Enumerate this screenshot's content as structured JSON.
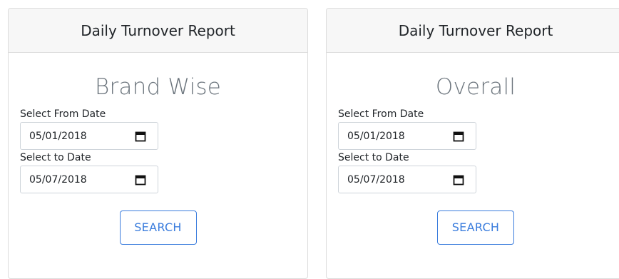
{
  "cards": [
    {
      "header": "Daily Turnover Report",
      "subtitle": "Brand Wise",
      "from_label": "Select From Date",
      "from_value": "05/01/2018",
      "to_label": "Select to Date",
      "to_value": "05/07/2018",
      "button_label": "SEARCH"
    },
    {
      "header": "Daily Turnover Report",
      "subtitle": "Overall",
      "from_label": "Select From Date",
      "from_value": "05/01/2018",
      "to_label": "Select to Date",
      "to_value": "05/07/2018",
      "button_label": "SEARCH"
    }
  ],
  "colors": {
    "accent": "#3b7ddd",
    "header_bg": "#f7f7f7",
    "subtitle": "#6c757d",
    "border": "#dcdcdc"
  },
  "icons": {
    "date_picker": "calendar-icon"
  }
}
